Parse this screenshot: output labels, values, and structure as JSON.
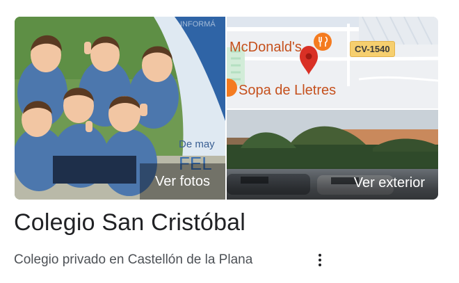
{
  "photos": {
    "main_caption": "Ver fotos",
    "main_banner_text_1": "De may",
    "main_banner_text_2": "FEL",
    "main_banner_text_3": "INFORMÁ"
  },
  "map": {
    "place_1": "McDonald's",
    "place_2": "Sopa de Lletres",
    "road_label": "CV-1540",
    "pin_color": "#d93025",
    "poi_color": "#f47b20"
  },
  "street": {
    "caption": "Ver exterior"
  },
  "place": {
    "title": "Colegio San Cristóbal",
    "subtitle": "Colegio privado en Castellón de la Plana",
    "more_icon": "more-vert-icon"
  }
}
